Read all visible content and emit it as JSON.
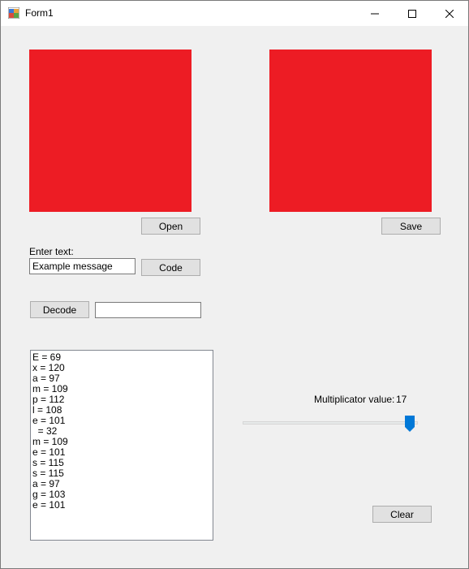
{
  "window": {
    "title": "Form1"
  },
  "colors": {
    "picture_fill": "#ED1C24",
    "slider_thumb": "#0078D7"
  },
  "buttons": {
    "open": "Open",
    "save": "Save",
    "code": "Code",
    "decode": "Decode",
    "clear": "Clear"
  },
  "input": {
    "label": "Enter text:",
    "value": "Example message",
    "decode_value": ""
  },
  "list": {
    "items": [
      "E = 69",
      "x = 120",
      "a = 97",
      "m = 109",
      "p = 112",
      "l = 108",
      "e = 101",
      "  = 32",
      "m = 109",
      "e = 101",
      "s = 115",
      "s = 115",
      "a = 97",
      "g = 103",
      "e = 101"
    ]
  },
  "slider": {
    "label": "Multiplicator value:",
    "value": "17",
    "fraction": 0.98
  }
}
